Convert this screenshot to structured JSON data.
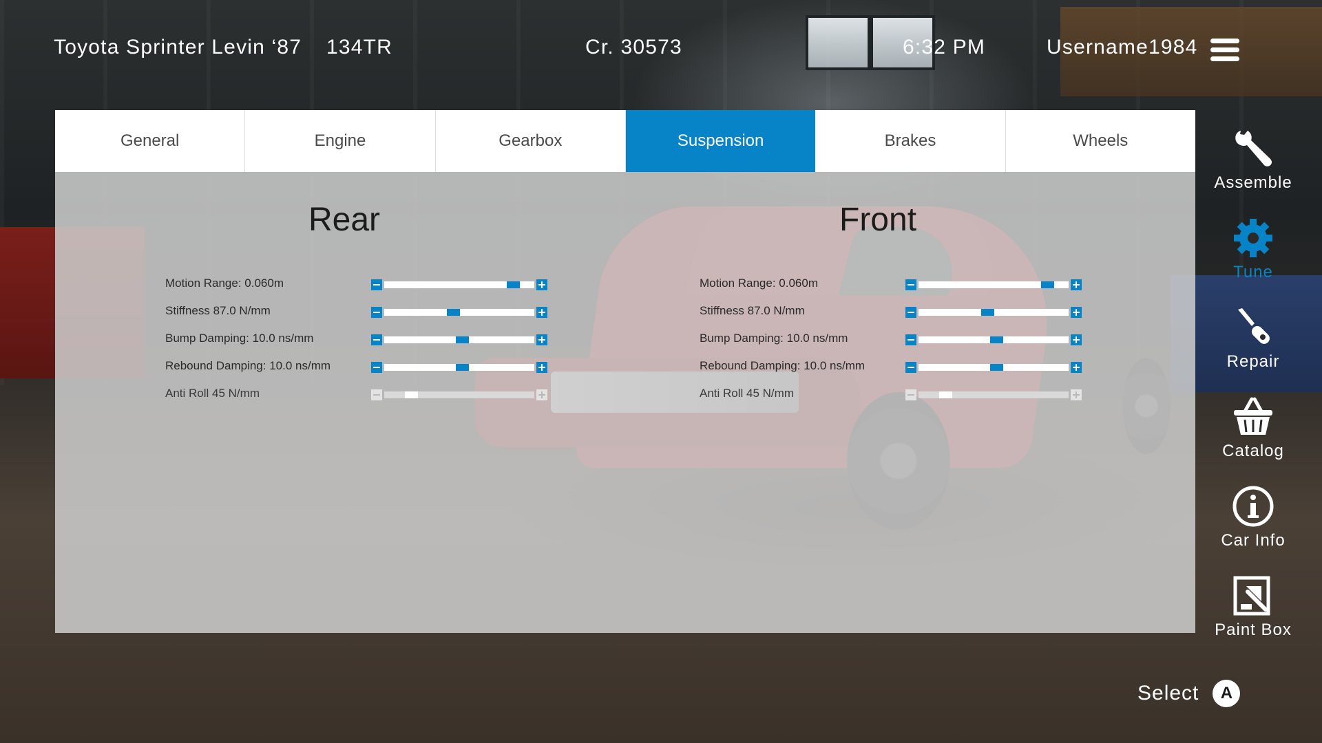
{
  "header": {
    "car_name": "Toyota Sprinter Levin ‘87",
    "car_code": "134TR",
    "credits": "Cr. 30573",
    "time": "6:32 PM",
    "username": "Username1984"
  },
  "tabs": [
    {
      "label": "General",
      "active": false
    },
    {
      "label": "Engine",
      "active": false
    },
    {
      "label": "Gearbox",
      "active": false
    },
    {
      "label": "Suspension",
      "active": true
    },
    {
      "label": "Brakes",
      "active": false
    },
    {
      "label": "Wheels",
      "active": false
    }
  ],
  "rear": {
    "title": "Rear",
    "params": [
      {
        "label": "Motion Range: 0.060m",
        "fraction": 0.86,
        "enabled": true
      },
      {
        "label": "Stiffness 87.0 N/mm",
        "fraction": 0.46,
        "enabled": true
      },
      {
        "label": "Bump Damping: 10.0 ns/mm",
        "fraction": 0.52,
        "enabled": true
      },
      {
        "label": "Rebound Damping: 10.0 ns/mm",
        "fraction": 0.52,
        "enabled": true
      },
      {
        "label": "Anti Roll 45 N/mm",
        "fraction": 0.18,
        "enabled": false
      }
    ]
  },
  "front": {
    "title": "Front",
    "params": [
      {
        "label": "Motion Range: 0.060m",
        "fraction": 0.86,
        "enabled": true
      },
      {
        "label": "Stiffness 87.0 N/mm",
        "fraction": 0.46,
        "enabled": true
      },
      {
        "label": "Bump Damping: 10.0 ns/mm",
        "fraction": 0.52,
        "enabled": true
      },
      {
        "label": "Rebound Damping: 10.0 ns/mm",
        "fraction": 0.52,
        "enabled": true
      },
      {
        "label": "Anti Roll 45 N/mm",
        "fraction": 0.18,
        "enabled": false
      }
    ]
  },
  "side_menu": [
    {
      "label": "Assemble",
      "icon": "wrench-icon",
      "active": false
    },
    {
      "label": "Tune",
      "icon": "gear-icon",
      "active": true
    },
    {
      "label": "Repair",
      "icon": "screwdriver-icon",
      "active": false
    },
    {
      "label": "Catalog",
      "icon": "basket-icon",
      "active": false
    },
    {
      "label": "Car Info",
      "icon": "info-icon",
      "active": false
    },
    {
      "label": "Paint Box",
      "icon": "paint-box-icon",
      "active": false
    }
  ],
  "footer": {
    "select_label": "Select",
    "button_glyph": "A"
  },
  "colors": {
    "accent": "#0784c7",
    "panel_bg": "#cecece",
    "tab_bg": "#ffffff"
  }
}
